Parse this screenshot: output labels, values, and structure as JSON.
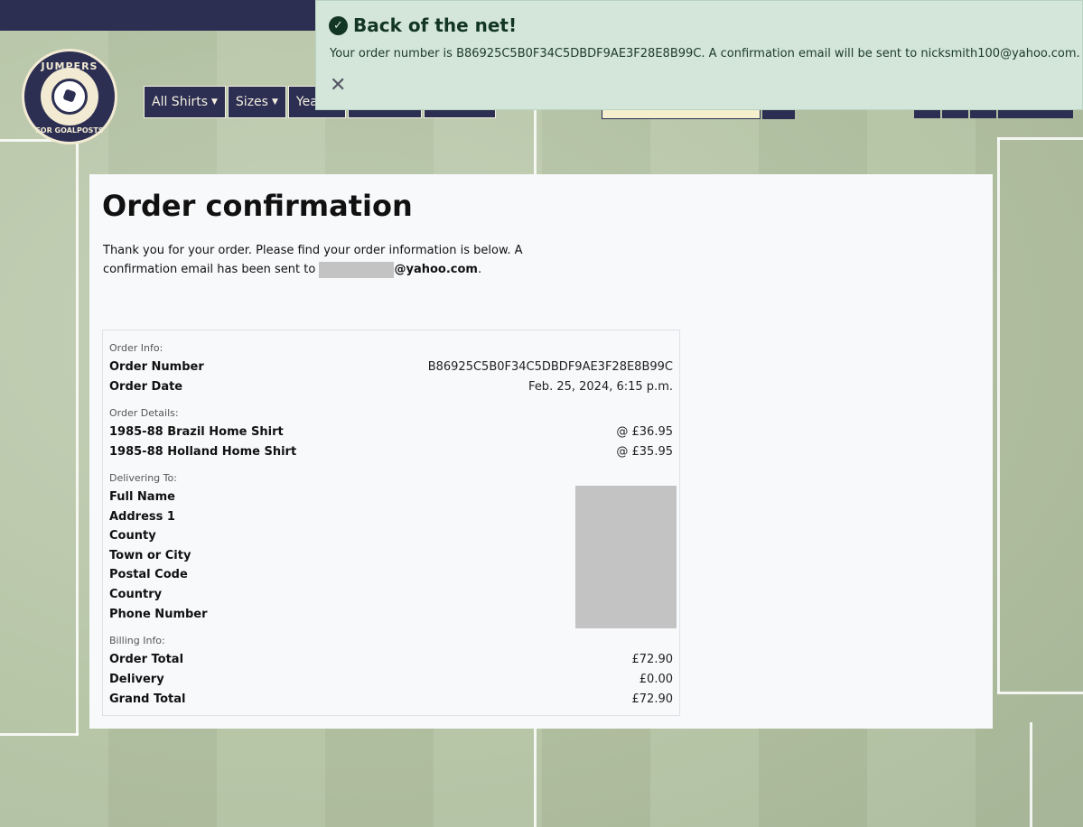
{
  "brand": {
    "logo_text_top": "JUMPERS",
    "logo_text_bottom": "FOR GOALPOSTS"
  },
  "nav": {
    "items": [
      {
        "label": "All Shirts"
      },
      {
        "label": "Sizes"
      },
      {
        "label": "Years"
      }
    ]
  },
  "toast": {
    "title": "Back of the net!",
    "message": "Your order number is B86925C5B0F34C5DBDF9AE3F28E8B99C. A confirmation email will be sent to nicksmith100@yahoo.com.",
    "close_icon": "close-icon",
    "success_color": "#123524"
  },
  "page": {
    "title": "Order confirmation",
    "intro_text": "Thank you for your order. Please find your order information is below. A confirmation email has been sent to",
    "email_suffix": "@yahoo.com",
    "intro_end": "."
  },
  "order_info": {
    "section_order": "Order Info:",
    "order_number_label": "Order Number",
    "order_number": "B86925C5B0F34C5DBDF9AE3F28E8B99C",
    "order_date_label": "Order Date",
    "order_date": "Feb. 25, 2024, 6:15 p.m.",
    "section_details": "Order Details:",
    "items": [
      {
        "name": "1985-88 Brazil Home Shirt",
        "price": "@ £36.95"
      },
      {
        "name": "1985-88 Holland Home Shirt",
        "price": "@ £35.95"
      }
    ],
    "section_delivery": "Delivering To:",
    "delivery_labels": [
      "Full Name",
      "Address 1",
      "County",
      "Town or City",
      "Postal Code",
      "Country",
      "Phone Number"
    ],
    "section_billing": "Billing Info:",
    "billing": [
      {
        "label": "Order Total",
        "value": "£72.90"
      },
      {
        "label": "Delivery",
        "value": "£0.00"
      },
      {
        "label": "Grand Total",
        "value": "£72.90"
      }
    ]
  },
  "colors": {
    "nav_bg": "#2c2f52",
    "search_bg": "#f6efcd",
    "toast_bg": "#d4e6d9"
  }
}
